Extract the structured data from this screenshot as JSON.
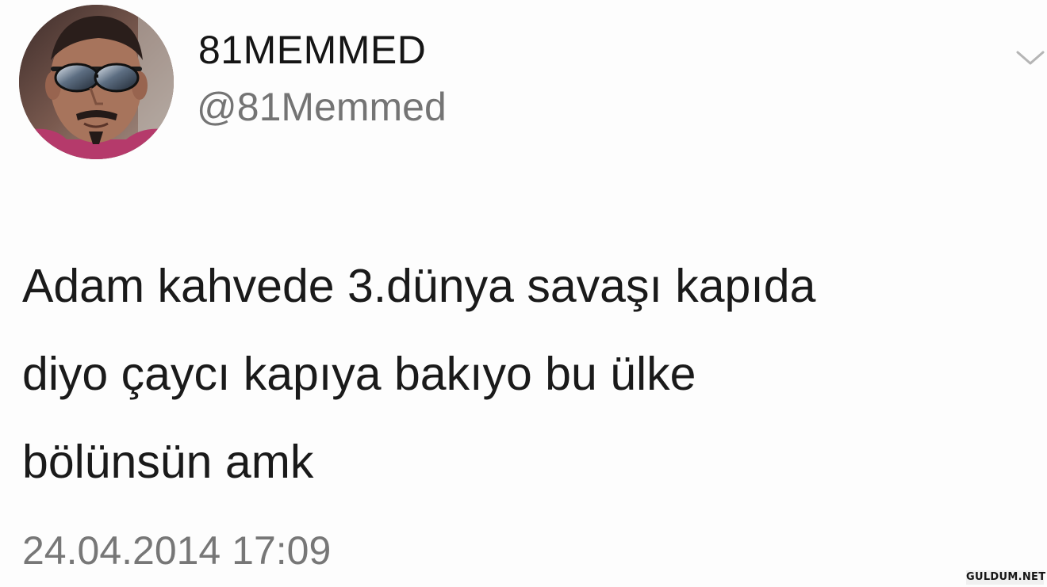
{
  "tweet": {
    "display_name": "81MEMMED",
    "handle": "@81Memmed",
    "text": "Adam kahvede 3.dünya savaşı kapıda\ndiyo çaycı kapıya bakıyo bu ülke\nbölünsün amk",
    "timestamp": "24.04.2014 17:09",
    "menu_icon": "chevron-down-icon",
    "avatar_icon": "profile-photo-sunglasses"
  },
  "watermark": {
    "text": "GULDUM.NET"
  },
  "colors": {
    "background": "#fdfdfd",
    "text": "#1a1a1a",
    "secondary_text": "#747474",
    "chevron": "#b5b5b5"
  }
}
